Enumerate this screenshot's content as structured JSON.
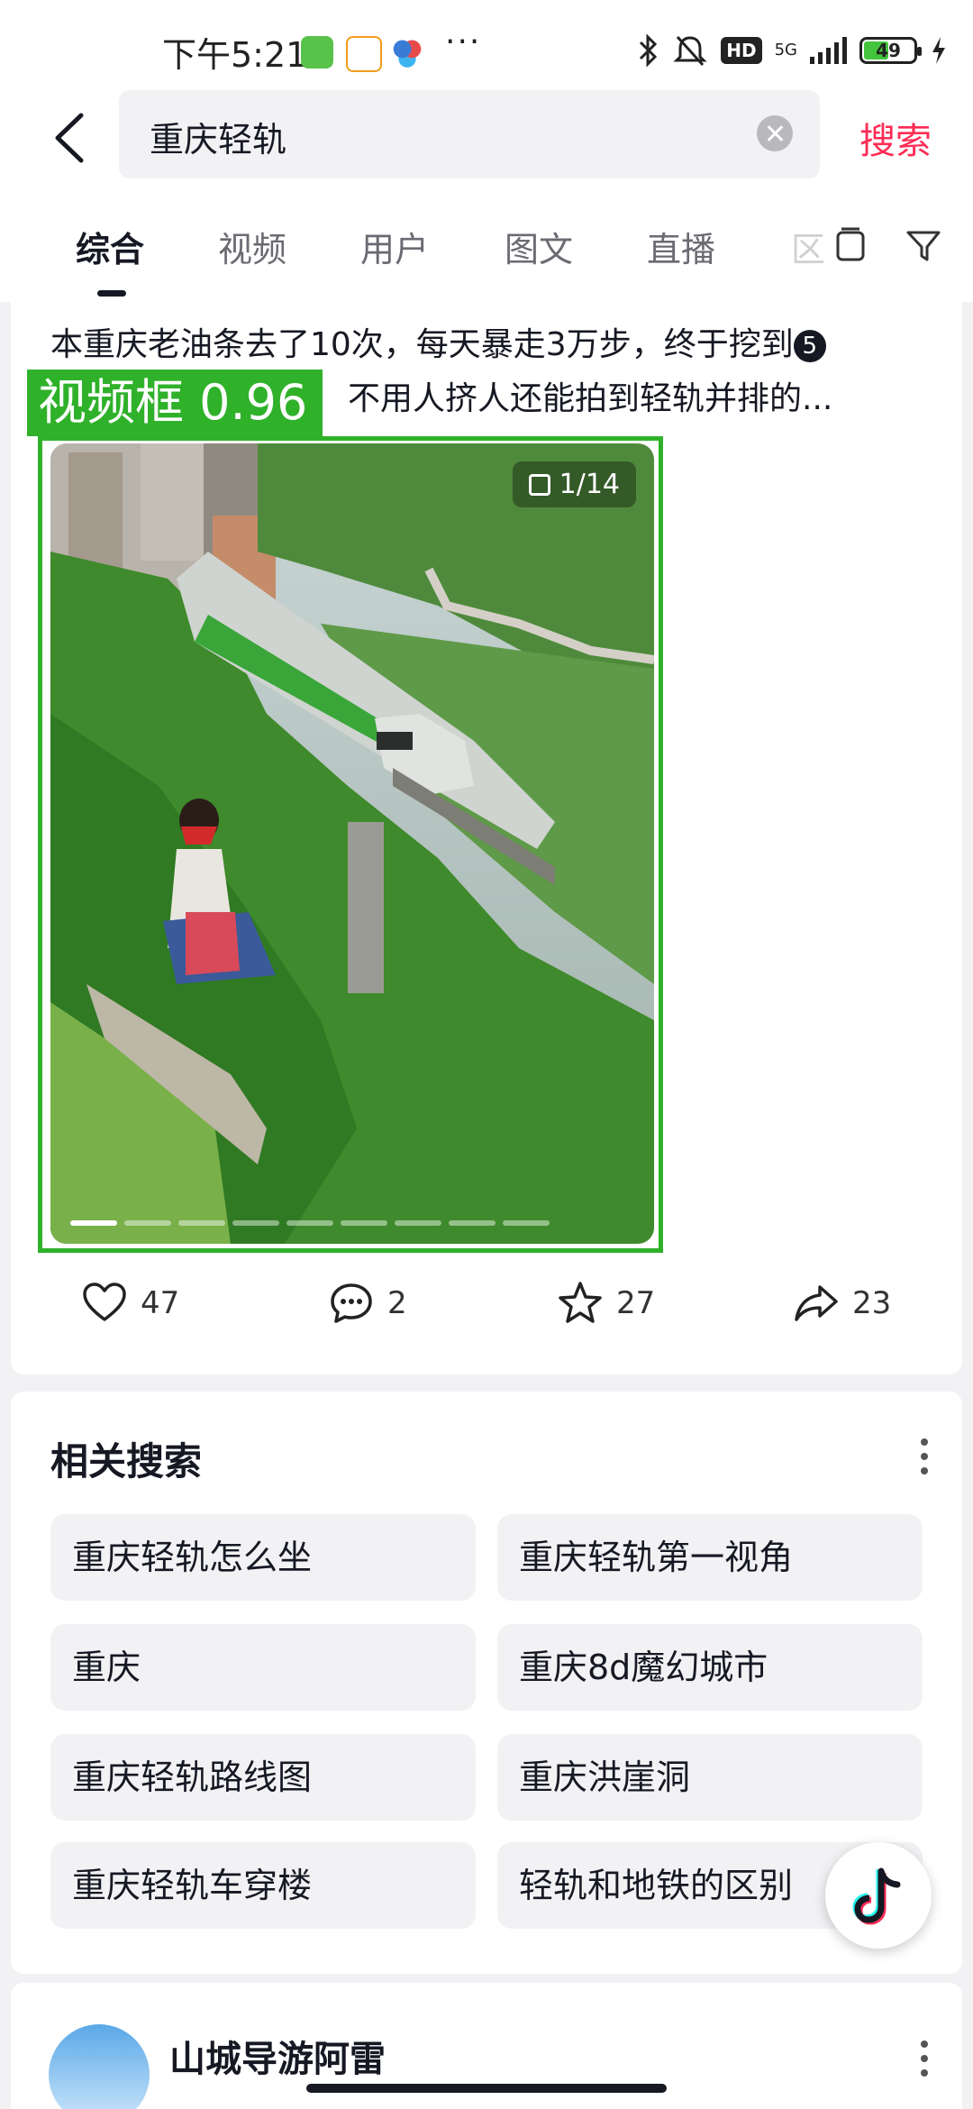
{
  "status_bar": {
    "time": "下午5:21",
    "icons": [
      "cat-app-icon",
      "58-app-icon",
      "baidu-netdisk-icon",
      "more-notifications-icon",
      "bluetooth-icon",
      "mute-icon",
      "hd-icon",
      "5g-signal-icon",
      "battery-icon",
      "charging-icon"
    ],
    "more": "···",
    "hd": "HD",
    "network": "5G",
    "battery_percent": "49"
  },
  "search": {
    "query": "重庆轻轨",
    "button_label": "搜索"
  },
  "tabs": [
    "综合",
    "视频",
    "用户",
    "图文",
    "直播",
    "区"
  ],
  "post": {
    "line1": "本重庆老油条去了10次，每天暴走3万步，终于挖到",
    "badge": "5",
    "line2": "不用人挤人还能拍到轻轨并排的...",
    "detection_label": "视频框 0.96",
    "image_counter": "1/14",
    "likes": "47",
    "comments": "2",
    "favorites": "27",
    "shares": "23"
  },
  "related": {
    "title": "相关搜索",
    "chips": [
      "重庆轻轨怎么坐",
      "重庆轻轨第一视角",
      "重庆",
      "重庆8d魔幻城市",
      "重庆轻轨路线图",
      "重庆洪崖洞",
      "重庆轻轨车穿楼",
      "轻轨和地铁的区别"
    ]
  },
  "next_post": {
    "username": "山城导游阿雷"
  },
  "colors": {
    "accent": "#fe2c55",
    "detection": "#2fb12a",
    "chip_bg": "#f2f2f4"
  }
}
